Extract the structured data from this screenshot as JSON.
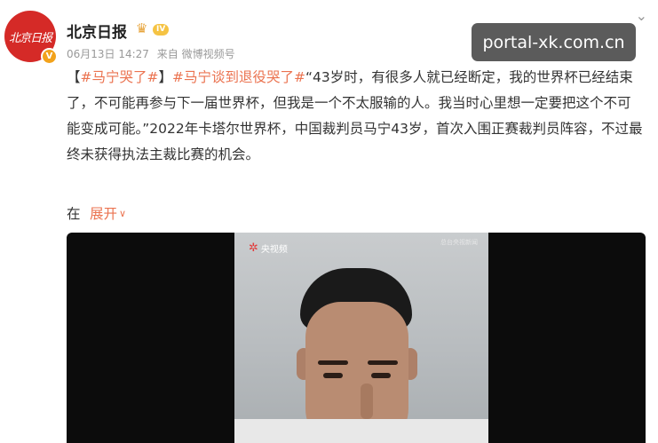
{
  "post": {
    "author": "北京日报",
    "avatar_text": "北京日报",
    "avatar_badge": "V",
    "level": "IV",
    "date": "06月13日 14:27",
    "source": "来自 微博视频号",
    "topic1": "#马宁哭了#",
    "topic2": "#马宁谈到退役哭了#",
    "bracket_open": "【",
    "bracket_close": "】",
    "body": "“43岁时，有很多人就已经断定，我的世界杯已经结束了，不可能再参与下一届世界杯，但我是一个不太服输的人。我当时心里想一定要把这个不可能变成可能。”2022年卡塔尔世界杯，中国裁判员马宁43岁，首次入围正赛裁判员阵容，不过最终未获得执法主裁比赛的机会。",
    "location_prefix": "在",
    "expand_label": "展开",
    "expand_icon": "chevron-down-icon"
  },
  "video": {
    "channel_logo": "央视频",
    "corner_mark": "总台央视新闻"
  },
  "watermark": "portal-xk.com.cn",
  "icons": {
    "menu": "chevron-down-icon",
    "vip": "crown-icon"
  },
  "colors": {
    "accent": "#eb7350",
    "avatar_bg": "#d52a27",
    "watermark_bg": "#5b5b5b"
  }
}
